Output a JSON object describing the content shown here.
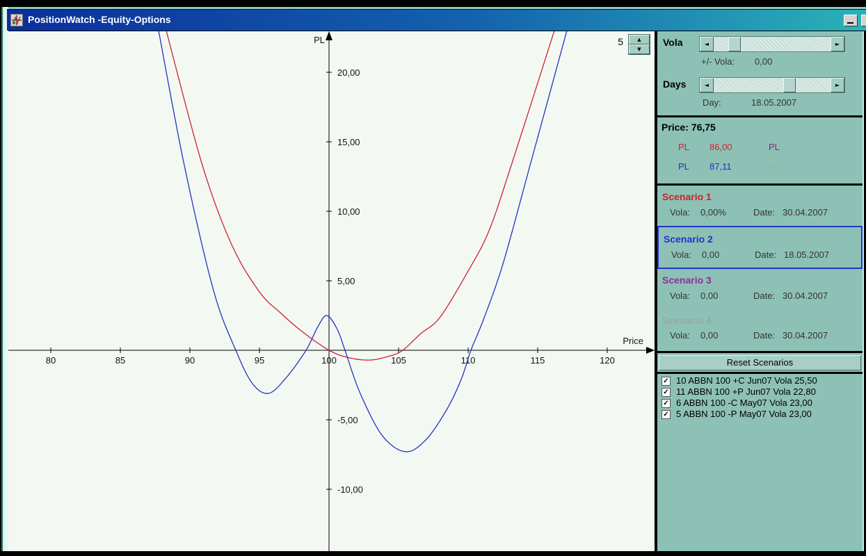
{
  "window": {
    "title": "PositionWatch -Equity-Options"
  },
  "chart": {
    "spinner_value": "5"
  },
  "chart_data": {
    "type": "line",
    "title": "",
    "xlabel": "Price",
    "ylabel": "PL",
    "xlim": [
      76.6,
      123.4
    ],
    "ylim": [
      -14.8,
      22.8
    ],
    "grid": false,
    "legend": "none",
    "x_tick_values": [
      80,
      85,
      90,
      95,
      100,
      105,
      110,
      115,
      120
    ],
    "x_tick_labels": [
      "80",
      "85",
      "90",
      "95",
      "100",
      "105",
      "110",
      "115",
      "120"
    ],
    "y_tick_values": [
      20,
      15,
      10,
      5,
      -5,
      -10
    ],
    "y_tick_labels": [
      "20,00",
      "15,00",
      "10,00",
      "5,00",
      "-5,00",
      "-10,00"
    ],
    "series": [
      {
        "name": "scenario-1-pl",
        "color": "#cc2233",
        "points": [
          [
            88.3,
            23
          ],
          [
            90.9,
            13.3
          ],
          [
            93.0,
            7.6
          ],
          [
            95.0,
            4.2
          ],
          [
            96.5,
            2.7
          ],
          [
            98.0,
            1.4
          ],
          [
            100.0,
            0
          ],
          [
            101.5,
            -0.55
          ],
          [
            103.0,
            -0.7
          ],
          [
            104.4,
            -0.4
          ],
          [
            105.3,
            0
          ],
          [
            106.6,
            1.2
          ],
          [
            108.0,
            2.4
          ],
          [
            110.0,
            5.7
          ],
          [
            111.5,
            8.6
          ],
          [
            113.1,
            13.3
          ],
          [
            116.2,
            23
          ]
        ]
      },
      {
        "name": "scenario-2-pl",
        "color": "#2233bb",
        "points": [
          [
            87.75,
            23
          ],
          [
            89.6,
            13.3
          ],
          [
            91.7,
            4.3
          ],
          [
            93.3,
            0
          ],
          [
            94.5,
            -2.4
          ],
          [
            95.65,
            -3.1
          ],
          [
            96.9,
            -2.0
          ],
          [
            98.35,
            0
          ],
          [
            99.2,
            1.7
          ],
          [
            99.85,
            2.5
          ],
          [
            100.6,
            1.5
          ],
          [
            101.15,
            0
          ],
          [
            102.2,
            -3.0
          ],
          [
            103.8,
            -6.1
          ],
          [
            105.5,
            -7.3
          ],
          [
            107.0,
            -6.4
          ],
          [
            108.5,
            -4.2
          ],
          [
            109.5,
            -2.1
          ],
          [
            110.2,
            0
          ],
          [
            111.1,
            2.2
          ],
          [
            112.5,
            6.2
          ],
          [
            114.45,
            13.3
          ],
          [
            117.1,
            23
          ]
        ]
      }
    ]
  },
  "sidebar": {
    "vola_label": "Vola",
    "vola_caption": "+/- Vola:",
    "vola_value": "0,00",
    "vola_slider_pos": 0.14,
    "days_label": "Days",
    "day_caption": "Day:",
    "day_value": "18.05.2007",
    "days_slider_pos": 0.66,
    "price_label": "Price:",
    "price_value": "76,75",
    "pl_rows": [
      {
        "label": "PL",
        "value": "86,00",
        "color": "#cc2233",
        "right_label": "PL",
        "right_color": "#882288"
      },
      {
        "label": "PL",
        "value": "87,11",
        "color": "#2233bb",
        "right_label": "PL",
        "right_color": "#9fb0aa"
      }
    ],
    "scenarios": [
      {
        "title": "Scenario 1",
        "color": "#cc2222",
        "vola_label": "Vola:",
        "vola": "0,00%",
        "date_label": "Date:",
        "date": "30.04.2007",
        "selected": false
      },
      {
        "title": "Scenario 2",
        "color": "#2233cc",
        "vola_label": "Vola:",
        "vola": "0,00",
        "date_label": "Date:",
        "date": "18.05.2007",
        "selected": true
      },
      {
        "title": "Scenario 3",
        "color": "#8b2e9b",
        "vola_label": "Vola:",
        "vola": "0,00",
        "date_label": "Date:",
        "date": "30.04.2007",
        "selected": false
      },
      {
        "title": "Scenario 4",
        "color": "#96a8a2",
        "vola_label": "Vola:",
        "vola": "0,00",
        "date_label": "Date:",
        "date": "30.04.2007",
        "selected": false
      }
    ],
    "reset_button_label": "Reset Scenarios",
    "positions": [
      {
        "checked": true,
        "label": "10 ABBN 100 +C Jun07 Vola 25,50"
      },
      {
        "checked": true,
        "label": "11 ABBN 100 +P Jun07 Vola 22,80"
      },
      {
        "checked": true,
        "label": "6 ABBN 100 -C May07 Vola 23,00"
      },
      {
        "checked": true,
        "label": "5 ABBN 100 -P May07 Vola 23,00"
      }
    ]
  },
  "colors": {
    "sidebar_bg": "#8ec1b5",
    "chart_bg": "#f3f8f3",
    "titlebar_left": "#0a2e9c",
    "titlebar_right": "#2ab2b8",
    "selected_scenario_border": "#2035c8"
  }
}
